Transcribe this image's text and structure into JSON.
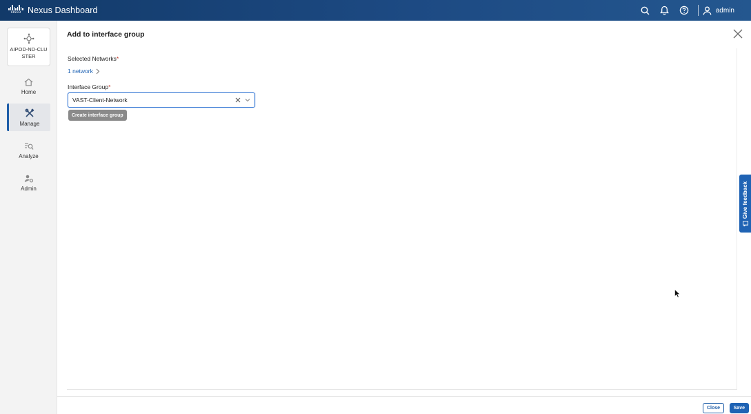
{
  "app": {
    "title": "Nexus Dashboard",
    "logo_word": "cisco"
  },
  "header": {
    "user_name": "admin",
    "icons": [
      "search-icon",
      "bell-icon",
      "help-icon",
      "user-icon"
    ]
  },
  "sidebar": {
    "cluster_name": "AIPOD-ND-CLUSTER",
    "items": [
      {
        "label": "Home",
        "icon": "home-icon"
      },
      {
        "label": "Manage",
        "icon": "tools-icon",
        "active": true
      },
      {
        "label": "Analyze",
        "icon": "analyze-icon"
      },
      {
        "label": "Admin",
        "icon": "admin-icon"
      }
    ]
  },
  "panel": {
    "title": "Add to interface group",
    "selected_networks_label": "Selected Networks",
    "selected_networks_link": "1 network",
    "interface_group_label": "Interface Group",
    "required_mark": "*",
    "interface_group_value": "VAST-Client-Network",
    "create_button": "Create interface group"
  },
  "footer": {
    "close_label": "Close",
    "save_label": "Save"
  },
  "feedback": {
    "label": "Give feedback"
  },
  "colors": {
    "accent": "#1f63b4",
    "topbar": "#1d4a83",
    "required": "#c0392b"
  }
}
